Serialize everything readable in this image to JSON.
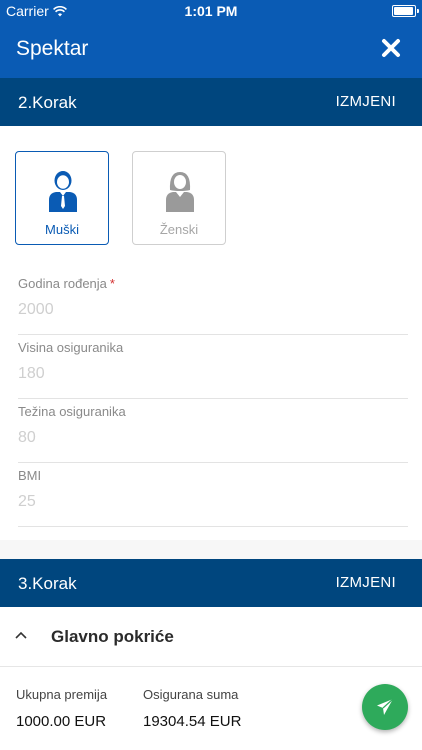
{
  "status_bar": {
    "carrier": "Carrier",
    "time": "1:01 PM"
  },
  "nav": {
    "title": "Spektar",
    "close_icon": "close-icon"
  },
  "step2": {
    "label": "2.Korak",
    "action": "IZMJENI"
  },
  "gender": {
    "options": [
      {
        "label": "Muški",
        "icon": "male-user-icon",
        "selected": true
      },
      {
        "label": "Ženski",
        "icon": "female-user-icon",
        "selected": false
      }
    ]
  },
  "fields": {
    "birth_year": {
      "label": "Godina rođenja",
      "required_mark": "*",
      "placeholder": "2000"
    },
    "height": {
      "label": "Visina osiguranika",
      "placeholder": "180"
    },
    "weight": {
      "label": "Težina osiguranika",
      "placeholder": "80"
    },
    "bmi": {
      "label": "BMI",
      "placeholder": "25"
    }
  },
  "step3": {
    "label": "3.Korak",
    "action": "IZMJENI"
  },
  "coverage": {
    "label": "Glavno pokriće",
    "icon": "chevron-up-icon"
  },
  "summary": {
    "premium_label": "Ukupna premija",
    "premium_value": "1000.00 EUR",
    "sum_label": "Osigurana suma",
    "sum_value": "19304.54 EUR"
  },
  "fab": {
    "icon": "send-icon"
  },
  "colors": {
    "primary": "#0a5bb4",
    "step_header": "#00467e",
    "fab": "#2eaa5b",
    "required": "#d32f2f"
  }
}
